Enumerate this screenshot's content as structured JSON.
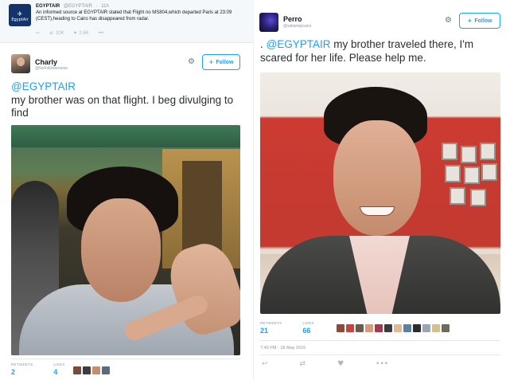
{
  "retweeted": {
    "logo_text": "EgyptAir",
    "name": "EGYPTAIR",
    "handle": "@EGYPTAIR",
    "time": "11h",
    "text": "An informed source at EGYPTAIR stated that Flight no MS804,which departed Paris at 23:09 (CEST),heading to Cairo has disappeared from radar.",
    "retweets": "10K",
    "likes": "2.6K",
    "more": "•••"
  },
  "left_tweet": {
    "name": "Charly",
    "handle": "@NoFollowersese",
    "follow_label": "Follow",
    "mention": "@EGYPTAIR",
    "text": "my brother was on that flight. I beg divulging to find",
    "retweets_label": "RETWEETS",
    "retweets": "2",
    "likes_label": "LIKES",
    "likes": "4",
    "liker_colors": [
      "#7a4a3a",
      "#3d3d3d",
      "#c78e6e",
      "#5b6b7b"
    ]
  },
  "right_tweet": {
    "name": "Perro",
    "handle": "@sidiamejicano",
    "follow_label": "Follow",
    "prefix": ". ",
    "mention": "@EGYPTAIR",
    "text": " my brother traveled there, I'm scared for her life. Please help me.",
    "retweets_label": "RETWEETS",
    "retweets": "21",
    "likes_label": "LIKES",
    "likes": "66",
    "liker_colors": [
      "#8b4a3c",
      "#c0463e",
      "#6b5b4e",
      "#d79a7a",
      "#a23a52",
      "#3b3b3b",
      "#e0b89a",
      "#5d7fa6",
      "#2c2c2c",
      "#9aa7b3",
      "#d6c08a",
      "#6f6a5e"
    ],
    "timestamp": "7:49 PM - 18 May 2016"
  },
  "icons": {
    "gear": "⚙",
    "follow_person": "👤+",
    "reply": "↩",
    "retweet": "⇄",
    "like": "♥",
    "more": "•••"
  },
  "colors": {
    "twitter_blue": "#1da1f2",
    "muted": "#8899a6",
    "egyptair_blue": "#12346b"
  }
}
